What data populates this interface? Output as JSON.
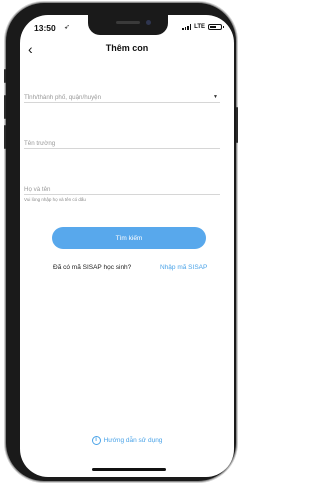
{
  "status_bar": {
    "time": "13:50",
    "location_icon": "➶",
    "network": "LTE"
  },
  "nav": {
    "back_icon": "‹",
    "title": "Thêm con"
  },
  "form": {
    "province_placeholder": "Tỉnh/thành phố, quận/huyện",
    "school_placeholder": "Tên trường",
    "name_placeholder": "Họ và tên",
    "name_hint": "Vui lòng nhập họ và tên có dấu",
    "dropdown_icon": "▼",
    "search_button": "Tìm kiếm"
  },
  "sisap": {
    "question": "Đã có mã SISAP học sinh?",
    "link": "Nhập mã SISAP"
  },
  "footer": {
    "guide_icon": "i",
    "guide_label": "Hướng dẫn sử dụng"
  },
  "colors": {
    "accent": "#58a8ec",
    "link": "#4aa3e8"
  },
  "battery_level": 0.45
}
